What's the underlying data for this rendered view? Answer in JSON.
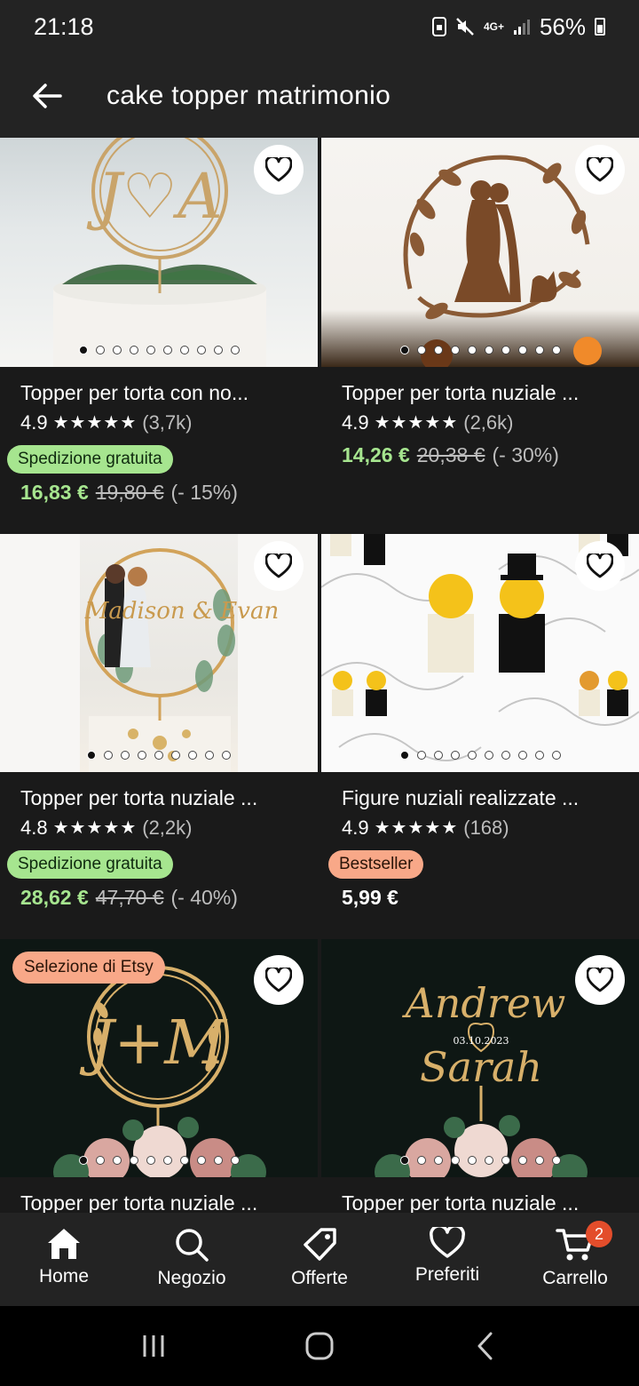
{
  "status_bar": {
    "time": "21:18",
    "network": "4G+",
    "battery": "56%"
  },
  "header": {
    "search_query": "cake topper matrimonio"
  },
  "products": [
    {
      "title": "Topper per torta con no...",
      "rating": "4.9",
      "stars": "★★★★★",
      "count": "(3,7k)",
      "badge": "Spedizione gratuita",
      "price": "16,83 €",
      "old_price": "19,80 €",
      "discount": "(- 15%)"
    },
    {
      "title": "Topper per torta nuziale ...",
      "rating": "4.9",
      "stars": "★★★★★",
      "count": "(2,6k)",
      "price": "14,26 €",
      "old_price": "20,38 €",
      "discount": "(- 30%)"
    },
    {
      "title": "Topper per torta nuziale ...",
      "rating": "4.8",
      "stars": "★★★★★",
      "count": "(2,2k)",
      "badge": "Spedizione gratuita",
      "price": "28,62 €",
      "old_price": "47,70 €",
      "discount": "(- 40%)",
      "image_text": "Madison & Evan"
    },
    {
      "title": "Figure nuziali realizzate ...",
      "rating": "4.9",
      "stars": "★★★★★",
      "count": "(168)",
      "badge": "Bestseller",
      "price": "5,99 €"
    },
    {
      "title": "Topper per torta nuziale ...",
      "badge": "Selezione di Etsy",
      "image_text": "J+M"
    },
    {
      "title": "Topper per torta nuziale ...",
      "image_text_top": "Andrew",
      "image_text_date": "03.10.2023",
      "image_text_bottom": "Sarah"
    }
  ],
  "bottom_nav": {
    "home": "Home",
    "shop": "Negozio",
    "offers": "Offerte",
    "favorites": "Preferiti",
    "cart": "Carrello",
    "cart_count": "2"
  },
  "colors": {
    "price_green": "#a6e58f",
    "badge_orange": "#f8a888",
    "cart_badge": "#e34d2b"
  }
}
